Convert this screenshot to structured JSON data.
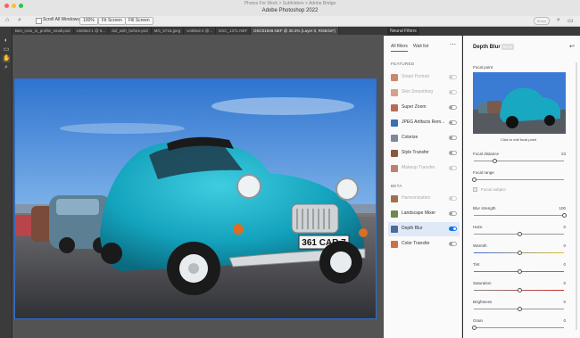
{
  "window": {
    "menu_title": "Photos For Work > Subfolders > Adobe Bridge",
    "app_title": "Adobe Photoshop 2022"
  },
  "options_bar": {
    "scroll_all_windows": "Scroll All Windows",
    "zoom": "100%",
    "fit_screen": "Fit Screen",
    "fill_screen": "Fill Screen",
    "share": "Share"
  },
  "doc_tabs": [
    "Ben_rose_in_profile_small.psd",
    "Untitled-1 @ 6...",
    "dof_with_before.psd",
    "MG_5715.jpeg",
    "Untitled-2 @...",
    "DSC_1371.NEF",
    "DSC01849.NEF @ 30.3% (Layer 0, RGB/16*)"
  ],
  "panel": {
    "header_label": "Neural Filters",
    "tabs": [
      "All filters",
      "Wait list"
    ],
    "sections": {
      "featured": "FEATURED",
      "beta": "BETA"
    },
    "featured_filters": [
      {
        "name": "Smart Portrait",
        "dim": true,
        "on": false
      },
      {
        "name": "Skin Smoothing",
        "dim": true,
        "on": false
      },
      {
        "name": "Super Zoom",
        "dim": false,
        "on": false
      },
      {
        "name": "JPEG Artifacts Rem...",
        "dim": false,
        "on": false
      },
      {
        "name": "Colorize",
        "dim": false,
        "on": false
      },
      {
        "name": "Style Transfer",
        "dim": false,
        "on": false
      },
      {
        "name": "Makeup Transfer",
        "dim": true,
        "on": false
      }
    ],
    "beta_filters": [
      {
        "name": "Harmonization",
        "dim": true,
        "on": false
      },
      {
        "name": "Landscape Mixer",
        "dim": false,
        "on": false
      },
      {
        "name": "Depth Blur",
        "dim": false,
        "on": true
      },
      {
        "name": "Color Transfer",
        "dim": false,
        "on": false
      }
    ]
  },
  "depth_blur": {
    "title": "Depth Blur",
    "beta_chip": "BETA",
    "focal_point_label": "Focal point",
    "click_hint": "Click to edit focal point",
    "focal_distance": {
      "label": "Focal distance",
      "value": "23"
    },
    "focal_range": {
      "label": "Focal range",
      "value": ""
    },
    "focus_subject": "Focus subject",
    "blur_strength": {
      "label": "Blur strength",
      "value": "100"
    },
    "haze": {
      "label": "Haze",
      "value": "0"
    },
    "warmth": {
      "label": "Warmth",
      "value": "0"
    },
    "tint": {
      "label": "Tint",
      "value": "0"
    },
    "saturation": {
      "label": "Saturation",
      "value": "0"
    },
    "brightness": {
      "label": "Brightness",
      "value": "0"
    },
    "grain": {
      "label": "Grain",
      "value": "0"
    }
  },
  "colors": {
    "accent": "#1473e6",
    "car": "#1aa7c0",
    "sky": "#4a8fe0"
  }
}
